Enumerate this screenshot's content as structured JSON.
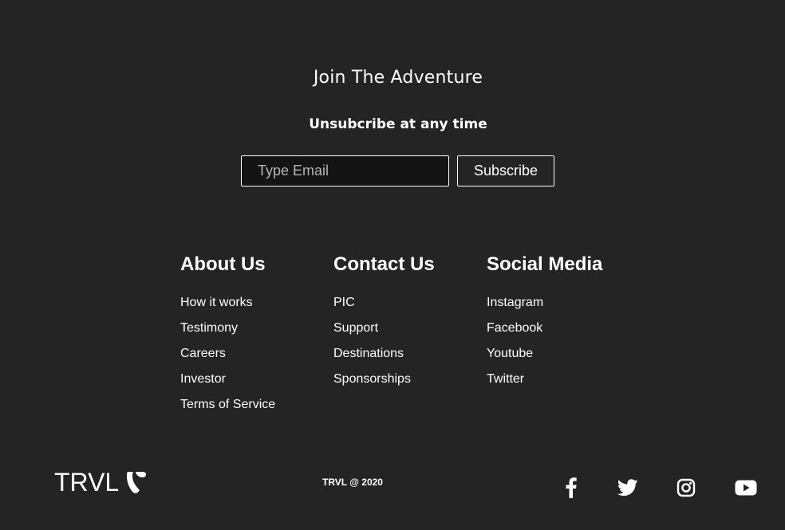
{
  "subscription": {
    "heading": "Join The Adventure",
    "subtext": "Unsubcribe at any time",
    "email_placeholder": "Type Email",
    "button_label": "Subscribe"
  },
  "columns": [
    {
      "title": "About Us",
      "links": [
        "How it works",
        "Testimony",
        "Careers",
        "Investor",
        "Terms of Service"
      ]
    },
    {
      "title": "Contact Us",
      "links": [
        "PIC",
        "Support",
        "Destinations",
        "Sponsorships"
      ]
    },
    {
      "title": "Social Media",
      "links": [
        "Instagram",
        "Facebook",
        "Youtube",
        "Twitter"
      ]
    }
  ],
  "footer": {
    "logo_text": "TRVL",
    "logo_icon": "typo3-icon",
    "copyright": "TRVL @ 2020",
    "social_icons": [
      "facebook-icon",
      "twitter-icon",
      "instagram-icon",
      "youtube-icon"
    ]
  },
  "colors": {
    "background": "#242424",
    "input_background": "#141414",
    "text": "#ffffff"
  }
}
